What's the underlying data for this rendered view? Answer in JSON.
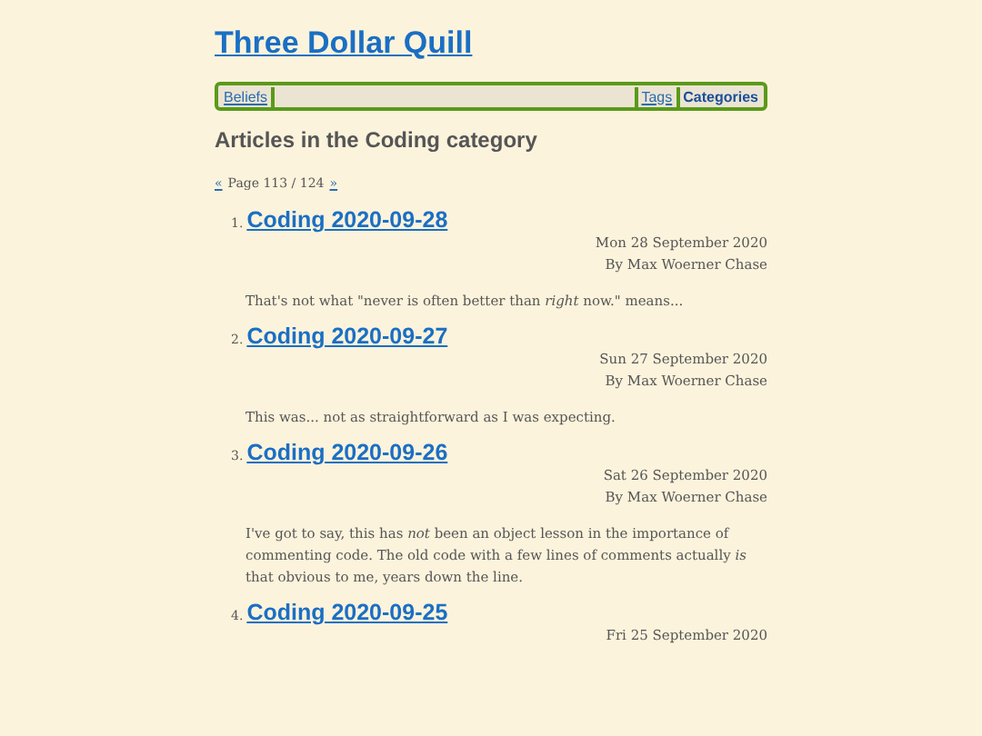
{
  "site_title": "Three Dollar Quill",
  "nav_left": [
    {
      "label": "Beliefs",
      "selected": false
    }
  ],
  "nav_right": [
    {
      "label": "Tags",
      "selected": false
    },
    {
      "label": "Categories",
      "selected": true
    }
  ],
  "heading": "Articles in the Coding category",
  "pagination": {
    "prev": "«",
    "text": "Page 113 / 124",
    "next": "»"
  },
  "articles": [
    {
      "number": "1.",
      "title": "Coding 2020-09-28",
      "date": "Mon 28 September 2020",
      "author": "By Max Woerner Chase",
      "summary": "That's not what \"never is often better than *right* now.\" means..."
    },
    {
      "number": "2.",
      "title": "Coding 2020-09-27",
      "date": "Sun 27 September 2020",
      "author": "By Max Woerner Chase",
      "summary": "This was... not as straightforward as I was expecting."
    },
    {
      "number": "3.",
      "title": "Coding 2020-09-26",
      "date": "Sat 26 September 2020",
      "author": "By Max Woerner Chase",
      "summary": "I've got to say, this has *not* been an object lesson in the importance of commenting code. The old code with a few lines of comments actually *is* that obvious to me, years down the line."
    },
    {
      "number": "4.",
      "title": "Coding 2020-09-25",
      "date": "Fri 25 September 2020"
    }
  ]
}
